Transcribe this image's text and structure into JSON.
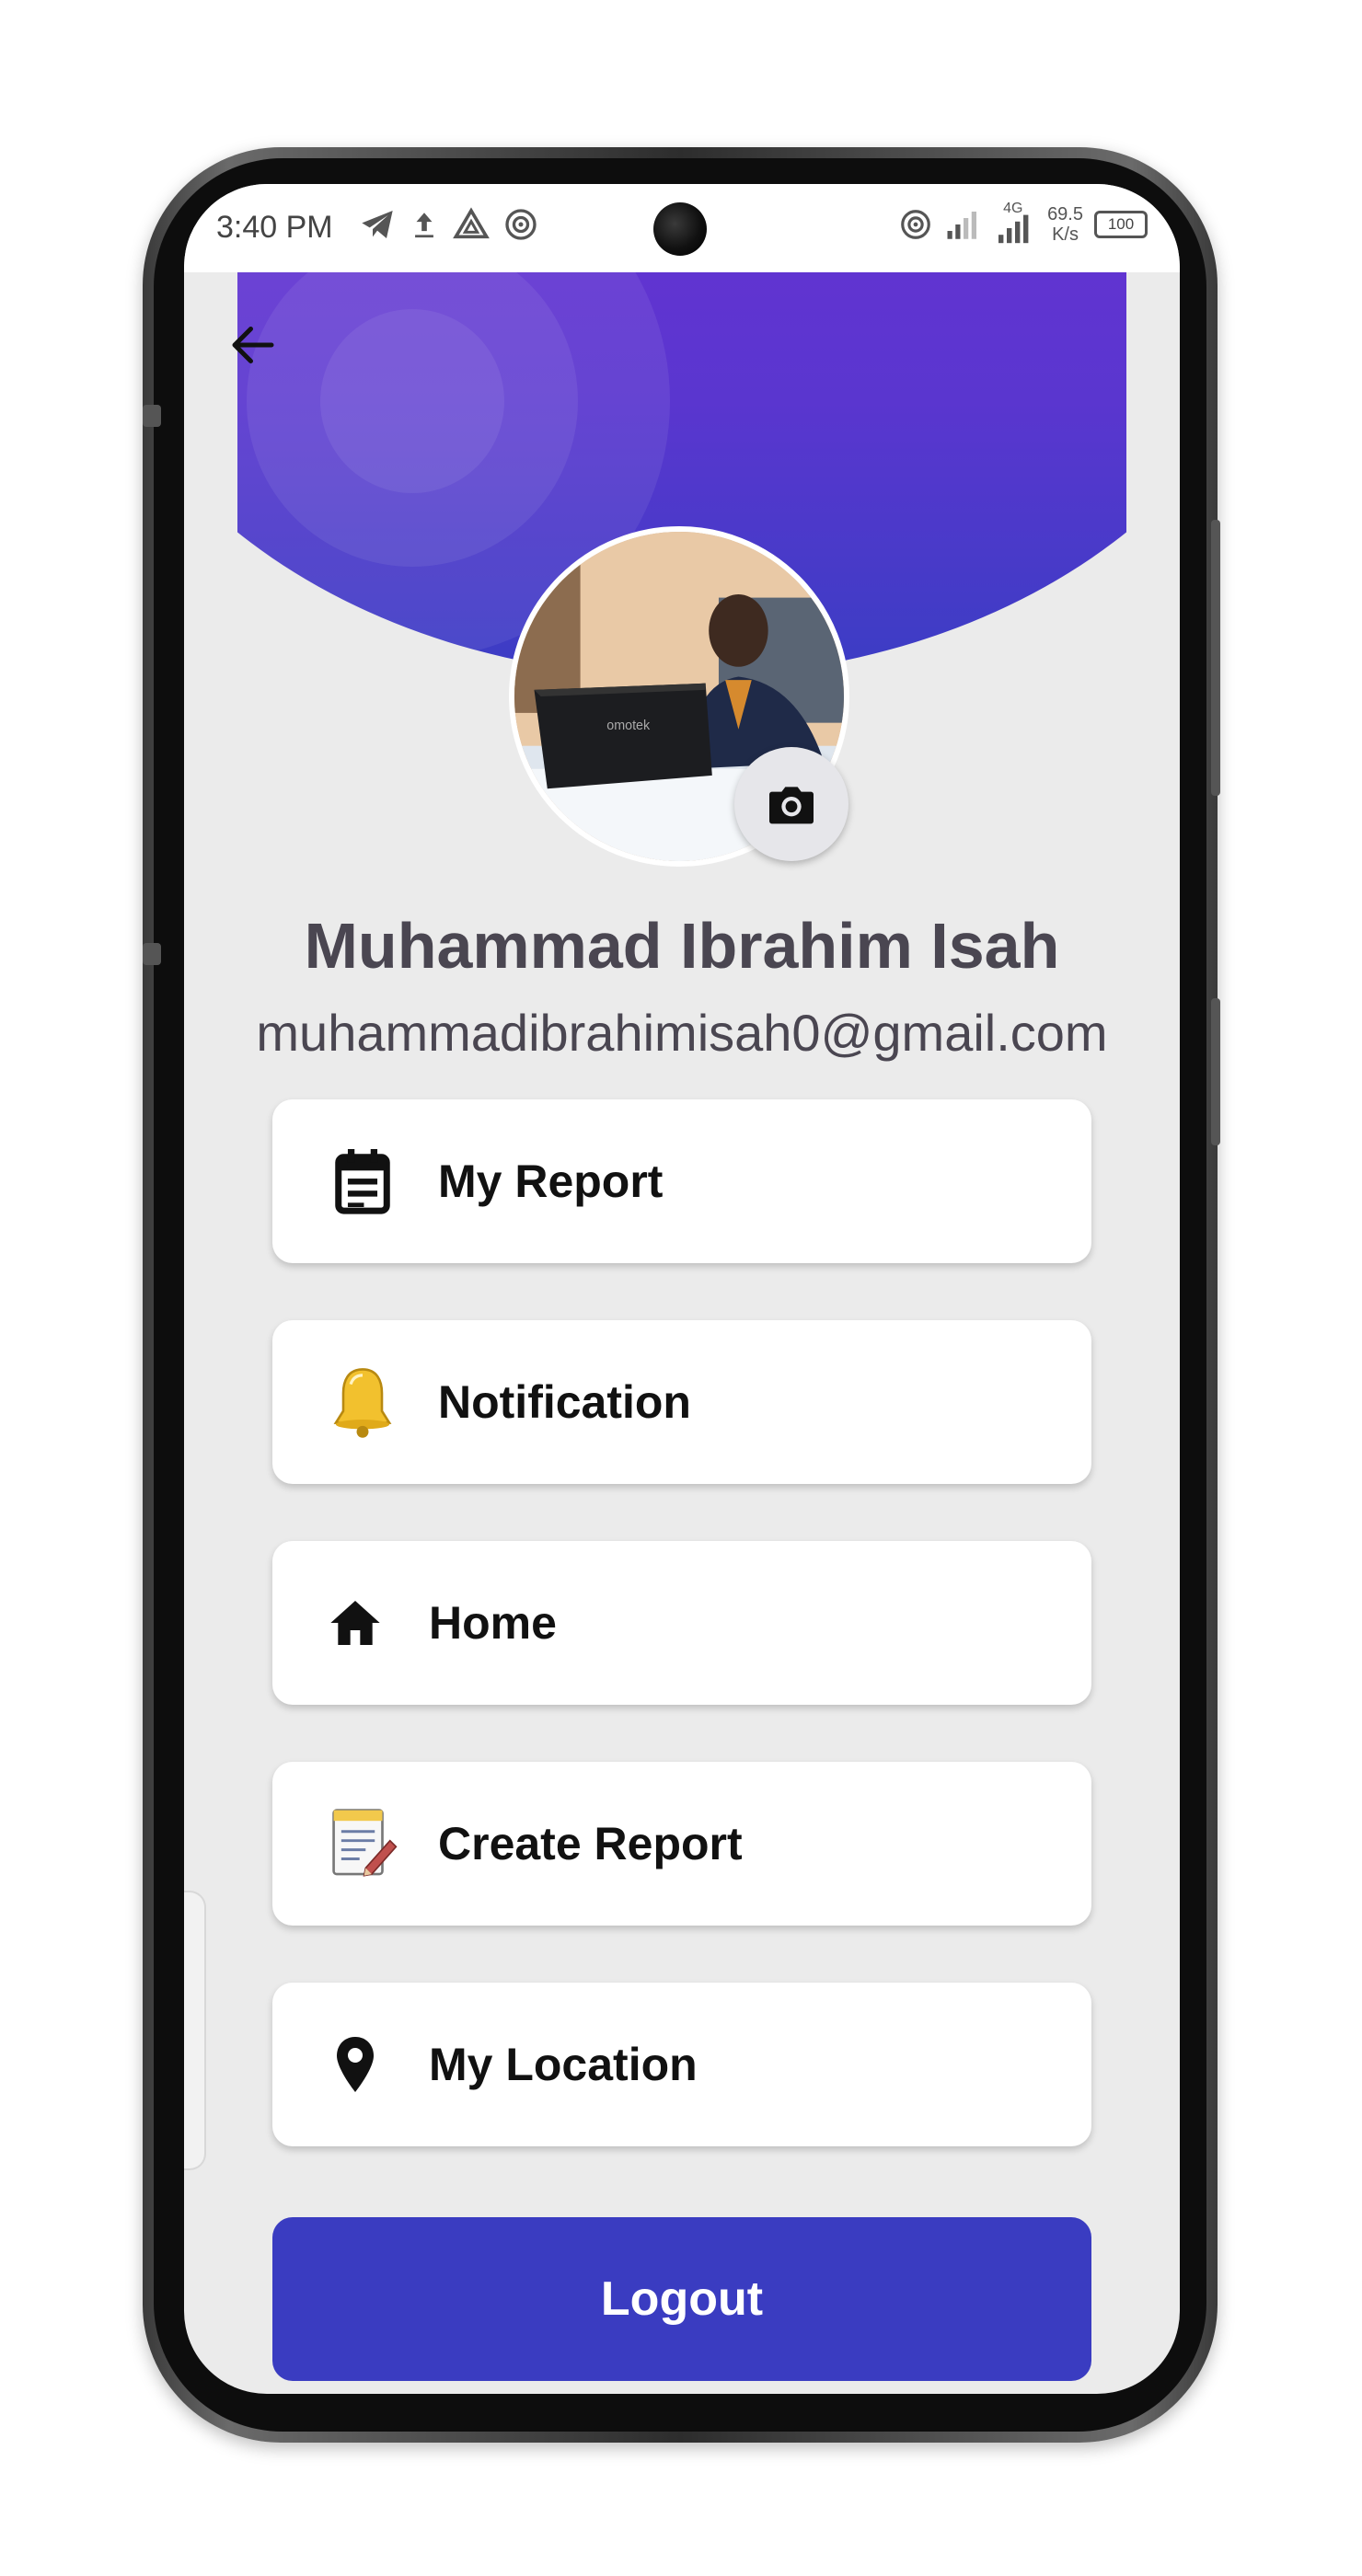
{
  "status_bar": {
    "time": "3:40 PM",
    "left_icons": [
      "telegram-icon",
      "upload-icon",
      "drive-icon",
      "hotspot-icon"
    ],
    "right_icons": [
      "hotspot-icon",
      "signal-icon",
      "signal-4g-icon"
    ],
    "network_speed_value": "69.5",
    "network_speed_unit": "K/s",
    "network_type": "4G",
    "battery": "100"
  },
  "header": {
    "gradient_top": "#7b2bd8",
    "gradient_bottom": "#3b3dc4",
    "back_icon": "arrow-left-icon"
  },
  "profile": {
    "name": "Muhammad Ibrahim Isah",
    "email": "muhammadibrahimisah0@gmail.com",
    "camera_icon": "camera-icon"
  },
  "menu": [
    {
      "label": "My Report",
      "icon": "calendar-report-icon"
    },
    {
      "label": "Notification",
      "icon": "bell-icon"
    },
    {
      "label": "Home",
      "icon": "home-icon"
    },
    {
      "label": "Create Report",
      "icon": "notepad-pencil-icon"
    },
    {
      "label": "My Location",
      "icon": "location-pin-icon"
    }
  ],
  "logout": {
    "label": "Logout",
    "color": "#3a3cc1"
  }
}
